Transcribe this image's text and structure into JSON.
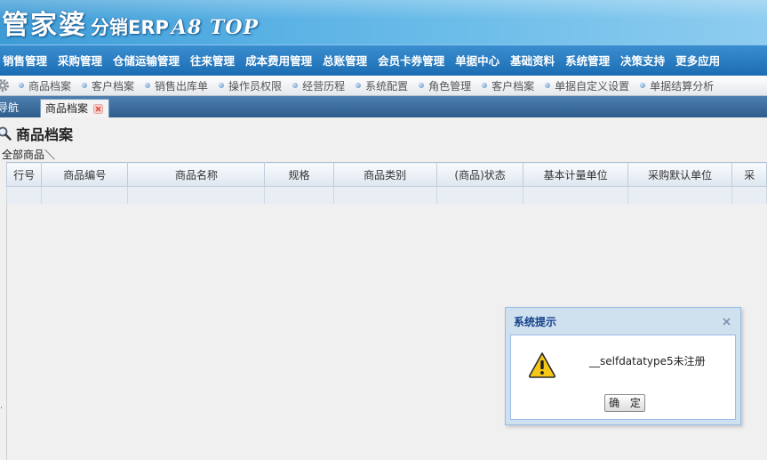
{
  "brand": {
    "name": "管家婆",
    "product": "分销ERP",
    "version": "A8 TOP"
  },
  "main_menu": [
    "销售管理",
    "采购管理",
    "仓储运输管理",
    "往来管理",
    "成本费用管理",
    "总账管理",
    "会员卡券管理",
    "单据中心",
    "基础资料",
    "系统管理",
    "决策支持",
    "更多应用"
  ],
  "quick_links": [
    "商品档案",
    "客户档案",
    "销售出库单",
    "操作员权限",
    "经营历程",
    "系统配置",
    "角色管理",
    "客户档案",
    "单据自定义设置",
    "单据结算分析"
  ],
  "tabs": {
    "inactive": "导航",
    "active": "商品档案"
  },
  "page": {
    "title": "商品档案",
    "breadcrumb": "全部商品＼"
  },
  "grid": {
    "columns": [
      "行号",
      "商品编号",
      "商品名称",
      "规格",
      "商品类别",
      "(商品)状态",
      "基本计量单位",
      "采购默认单位",
      "采"
    ]
  },
  "dialog": {
    "title": "系统提示",
    "message": "__selfdatatype5未注册",
    "ok_label": "确 定"
  },
  "icons": {
    "gear": "gear-icon",
    "tab_close": "close-icon",
    "title": "search-icon",
    "warning": "warning-icon",
    "dialog_close": "close-icon"
  },
  "colors": {
    "header": "#4aa5dc",
    "menu": "#2776bd",
    "tabbar": "#3d6e9f",
    "dialog_title": "#15428b",
    "warning": "#f4c20d"
  }
}
